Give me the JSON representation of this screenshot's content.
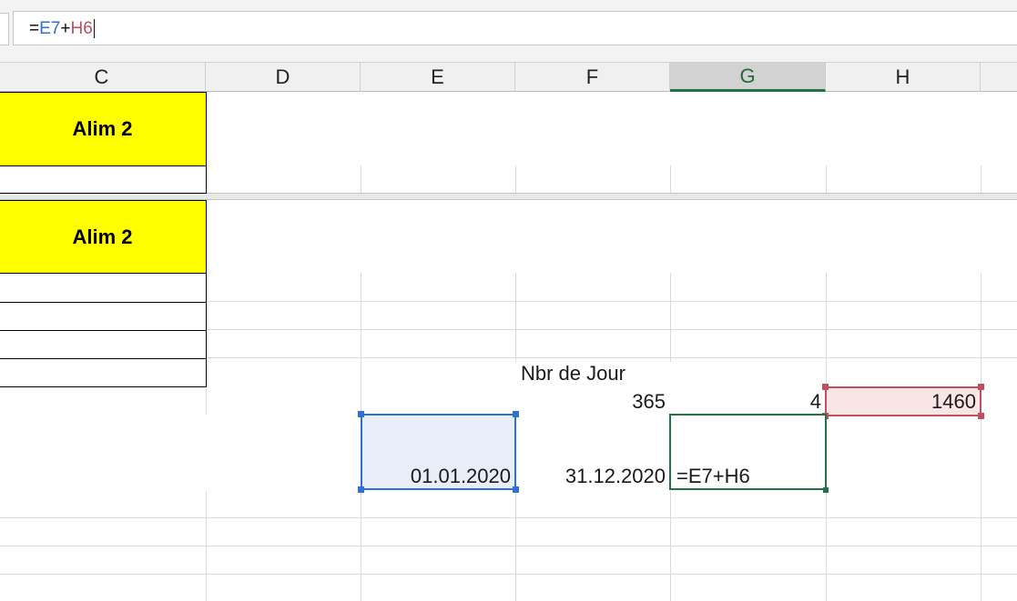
{
  "formula_bar": {
    "prefix": "=",
    "ref1": "E7",
    "op": "+",
    "ref2": "H6"
  },
  "columns": [
    "C",
    "D",
    "E",
    "F",
    "G",
    "H"
  ],
  "selected_column": "G",
  "cells": {
    "c_alim_top": "Alim 2",
    "c_alim_bottom": "Alim 2",
    "f_label": "Nbr de Jour",
    "f_days": "365",
    "g_multiplier": "4",
    "h_total": "1460",
    "e_start_date": "01.01.2020",
    "f_end_date": "31.12.2020",
    "g_formula": "=E7+H6"
  },
  "colors": {
    "yellow_fill": "#ffff00",
    "ref_blue": "#2f6fd6",
    "ref_red": "#c0505d",
    "active_green": "#217346"
  }
}
